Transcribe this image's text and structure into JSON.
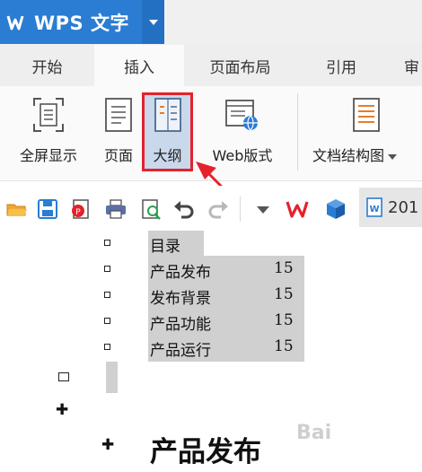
{
  "app": {
    "title": "WPS 文字"
  },
  "tabs": [
    {
      "label": "开始",
      "active": false
    },
    {
      "label": "插入",
      "active": true
    },
    {
      "label": "页面布局",
      "active": false
    },
    {
      "label": "引用",
      "active": false
    },
    {
      "label": "审",
      "active": false
    }
  ],
  "ribbon": {
    "fullscreen": "全屏显示",
    "page": "页面",
    "outline": "大纲",
    "web": "Web版式",
    "docmap": "文档结构图"
  },
  "quick_access": {
    "icons": [
      "open-icon",
      "save-icon",
      "export-pdf-icon",
      "print-icon",
      "print-preview-icon",
      "undo-icon",
      "redo-icon",
      "customize-dropdown-icon",
      "wps-logo-icon",
      "cube-icon",
      "document-icon"
    ],
    "doc_tab_label": "201"
  },
  "document": {
    "toc_title": "目录",
    "toc_items": [
      {
        "text": "产品发布",
        "page": "15"
      },
      {
        "text": "发布背景",
        "page": "15"
      },
      {
        "text": "产品功能",
        "page": "15"
      },
      {
        "text": "产品运行",
        "page": "15"
      }
    ],
    "heading": "产品发布",
    "watermark": "Bai"
  },
  "colors": {
    "brand_blue": "#2b7cd3",
    "highlight_red": "#e4222c",
    "selected_bg": "#c9d8ea",
    "toc_highlight": "#d0d0d0"
  }
}
